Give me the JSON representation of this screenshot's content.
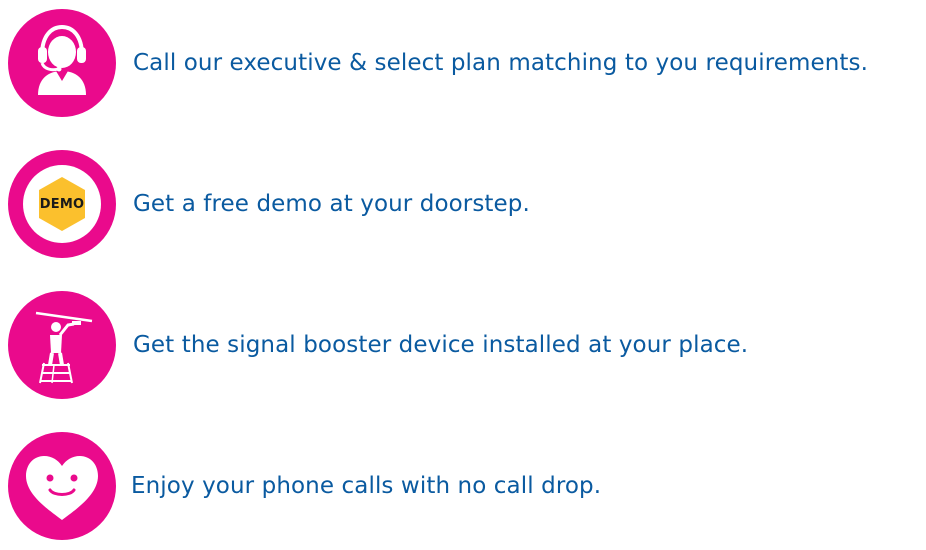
{
  "steps": [
    {
      "icon": "headset-agent-icon",
      "text": "Call our executive & select plan matching to you requirements."
    },
    {
      "icon": "demo-badge-icon",
      "badge": "DEMO",
      "text": "Get a free demo at your doorstep."
    },
    {
      "icon": "installer-on-ladder-icon",
      "text": "Get the signal booster device installed at your place."
    },
    {
      "icon": "smiling-heart-icon",
      "text": "Enjoy your phone calls with no call drop."
    }
  ],
  "colors": {
    "circle": "#ea0a8c",
    "text": "#0a5aa0",
    "badge": "#fbc02d"
  }
}
